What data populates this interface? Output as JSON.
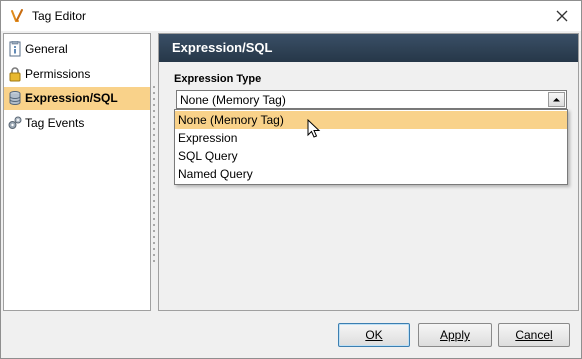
{
  "window": {
    "title": "Tag Editor"
  },
  "nav": {
    "items": [
      {
        "label": "General",
        "icon": "info-document-icon"
      },
      {
        "label": "Permissions",
        "icon": "lock-icon"
      },
      {
        "label": "Expression/SQL",
        "icon": "database-icon",
        "selected": true
      },
      {
        "label": "Tag Events",
        "icon": "gears-icon"
      }
    ]
  },
  "panel": {
    "title": "Expression/SQL",
    "expression_type": {
      "label": "Expression Type",
      "value": "None (Memory Tag)",
      "options": [
        "None (Memory Tag)",
        "Expression",
        "SQL Query",
        "Named Query"
      ]
    }
  },
  "buttons": {
    "ok": "OK",
    "apply": "Apply",
    "cancel": "Cancel"
  },
  "colors": {
    "selection": "#f9d28a",
    "header": "#2f4356",
    "default_border": "#3c7fb1"
  }
}
